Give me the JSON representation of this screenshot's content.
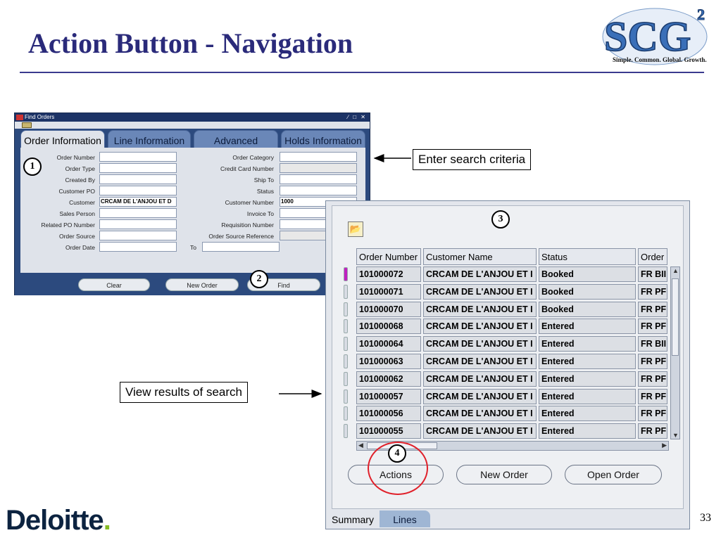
{
  "slide": {
    "title": "Action Button - Navigation",
    "page_number": "33"
  },
  "logos": {
    "scg_text": "SCG",
    "scg_superscript": "2",
    "scg_tagline": "Simple. Common. Global. Growth.",
    "deloitte_text": "Deloitte",
    "deloitte_dot": "."
  },
  "colors": {
    "title": "#2a2a7a",
    "window_frame": "#2c4a7e",
    "selected_row_marker": "#c020c0",
    "highlight_ring": "#e0202a"
  },
  "find_window": {
    "title": "Find Orders",
    "tabs": [
      "Order Information",
      "Line Information",
      "Advanced",
      "Holds Information"
    ],
    "active_tab": "Order Information",
    "left_fields": [
      {
        "label": "Order Number",
        "value": ""
      },
      {
        "label": "Order Type",
        "value": ""
      },
      {
        "label": "Created By",
        "value": ""
      },
      {
        "label": "Customer PO",
        "value": ""
      },
      {
        "label": "Customer",
        "value": "CRCAM DE L'ANJOU ET D"
      },
      {
        "label": "Sales Person",
        "value": ""
      },
      {
        "label": "Related PO Number",
        "value": ""
      },
      {
        "label": "Order Source",
        "value": ""
      },
      {
        "label": "Order Date",
        "value": ""
      }
    ],
    "right_fields": [
      {
        "label": "Order Category",
        "value": ""
      },
      {
        "label": "Credit Card Number",
        "value": ""
      },
      {
        "label": "Ship To",
        "value": ""
      },
      {
        "label": "Status",
        "value": ""
      },
      {
        "label": "Customer Number",
        "value": "1000"
      },
      {
        "label": "Invoice To",
        "value": ""
      },
      {
        "label": "Requisition Number",
        "value": ""
      },
      {
        "label": "Order Source Reference",
        "value": ""
      }
    ],
    "to_label": "To",
    "buttons": {
      "clear": "Clear",
      "new_order": "New Order",
      "find": "Find"
    }
  },
  "results_window": {
    "columns": [
      "Order Number",
      "Customer Name",
      "Status",
      "Order"
    ],
    "rows": [
      [
        "101000072",
        "CRCAM DE L'ANJOU ET I",
        "Booked",
        "FR BII"
      ],
      [
        "101000071",
        "CRCAM DE L'ANJOU ET I",
        "Booked",
        "FR PF"
      ],
      [
        "101000070",
        "CRCAM DE L'ANJOU ET I",
        "Booked",
        "FR PF"
      ],
      [
        "101000068",
        "CRCAM DE L'ANJOU ET I",
        "Entered",
        "FR PF"
      ],
      [
        "101000064",
        "CRCAM DE L'ANJOU ET I",
        "Entered",
        "FR BII"
      ],
      [
        "101000063",
        "CRCAM DE L'ANJOU ET I",
        "Entered",
        "FR PF"
      ],
      [
        "101000062",
        "CRCAM DE L'ANJOU ET I",
        "Entered",
        "FR PF"
      ],
      [
        "101000057",
        "CRCAM DE L'ANJOU ET I",
        "Entered",
        "FR PF"
      ],
      [
        "101000056",
        "CRCAM DE L'ANJOU ET I",
        "Entered",
        "FR PF"
      ],
      [
        "101000055",
        "CRCAM DE L'ANJOU ET I",
        "Entered",
        "FR PF"
      ]
    ],
    "selected_row": 0,
    "buttons": {
      "actions": "Actions",
      "new_order": "New Order",
      "open_order": "Open Order"
    },
    "bottom_tabs": [
      "Summary",
      "Lines"
    ],
    "active_bottom_tab": "Summary"
  },
  "annotations": {
    "enter_search": "Enter search criteria",
    "view_results": "View results of search",
    "step1": "1",
    "step2": "2",
    "step3": "3",
    "step4": "4"
  }
}
